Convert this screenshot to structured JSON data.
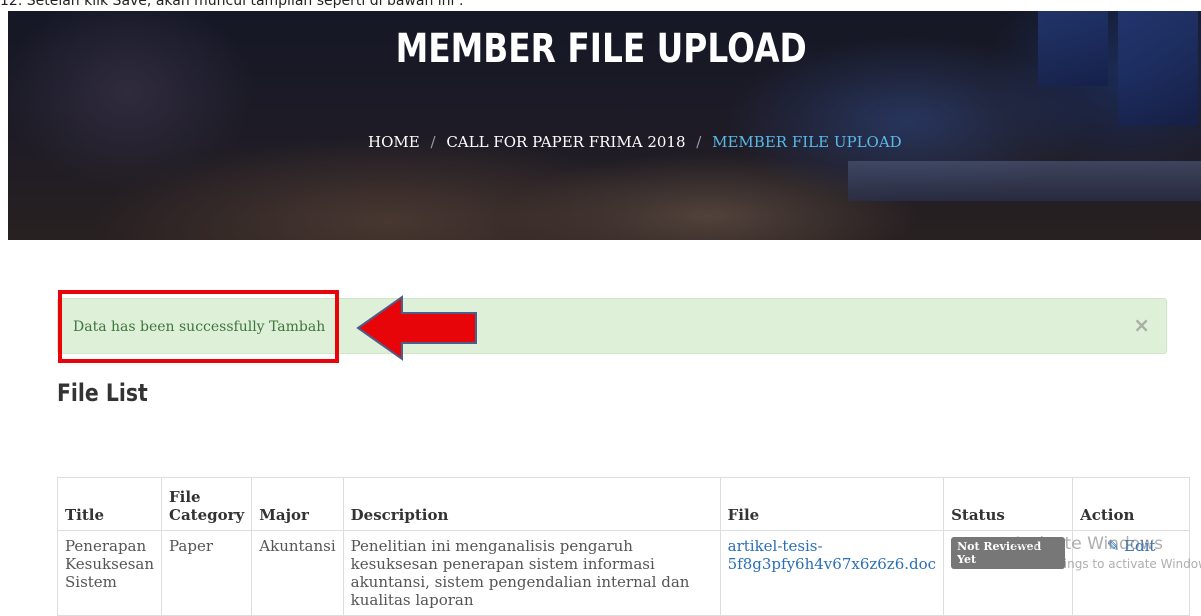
{
  "caption": "12. Setelah klik Save, akan muncul tampilan seperti di bawah ini :",
  "hero": {
    "title": "MEMBER FILE UPLOAD",
    "breadcrumb": [
      {
        "label": "HOME"
      },
      {
        "label": "CALL FOR PAPER FRIMA 2018"
      },
      {
        "label": "MEMBER FILE UPLOAD"
      }
    ],
    "separator": "/"
  },
  "alert": {
    "message": "Data has been successfully Tambah",
    "close_icon": "×"
  },
  "colors": {
    "alert_bg": "#dff0d8",
    "alert_text": "#3c763d",
    "highlight_red": "#e8050a",
    "link_blue": "#2a6fb8",
    "breadcrumb_active": "#5bb9e8",
    "badge_gray": "#777777"
  },
  "file_list": {
    "title": "File List",
    "columns": [
      "Title",
      "File Category",
      "Major",
      "Description",
      "File",
      "Status",
      "Action"
    ],
    "rows": [
      {
        "title": "Penerapan Kesuksesan Sistem",
        "category": "Paper",
        "major": "Akuntansi",
        "description": "Penelitian ini menganalisis pengaruh kesuksesan penerapan sistem informasi akuntansi, sistem pengendalian internal dan kualitas laporan",
        "file": "artikel-tesis-5f8g3pfy6h4v67x6z6z6.doc",
        "status": "Not Reviewed Yet",
        "action": "Edit",
        "action_icon": "pencil-icon"
      }
    ]
  },
  "watermark": {
    "title": "Activate Windows",
    "subtitle": "Go to PC settings to activate Windows."
  }
}
